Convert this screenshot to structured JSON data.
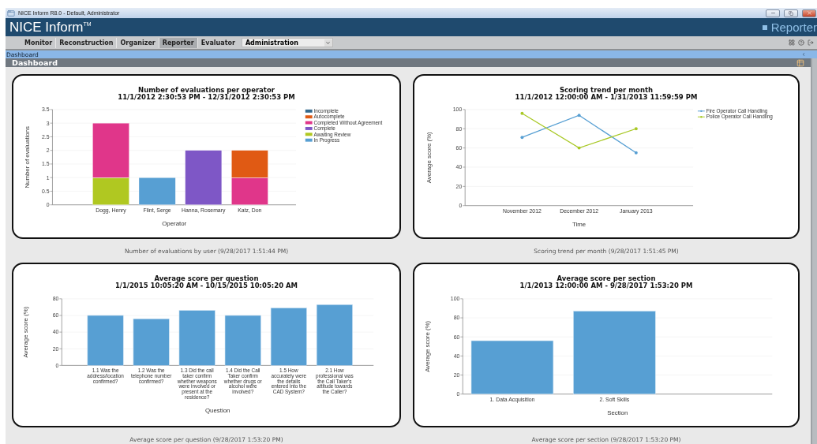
{
  "window": {
    "title": "NICE Inform R8.0 - Default, Administrator"
  },
  "header": {
    "brand": "NICE Inform$^{TM}$",
    "module": "Reporter"
  },
  "nav": {
    "items": [
      {
        "label": "Monitor",
        "selected": false
      },
      {
        "label": "Reconstruction",
        "selected": false
      },
      {
        "label": "Organizer",
        "selected": false
      },
      {
        "label": "Reporter",
        "selected": true
      },
      {
        "label": "Evaluator",
        "selected": false
      }
    ],
    "dropdown": {
      "value": "Administration"
    }
  },
  "breadcrumb": "Dashboard",
  "page_title": "Dashboard",
  "widgets": [
    {
      "caption": "Number of evaluations by user (9/28/2017 1:51:44 PM)",
      "period": "11/1/2012 2:30:53 PM - 12/31/2012 2:30:53 PM",
      "chart_data": {
        "type": "bar",
        "stacked": true,
        "grid": true,
        "legend": true,
        "title": "Number of evaluations per operator",
        "xlabel": "Operator",
        "ylabel": "Number of evaluations",
        "categories": [
          "Dogg, Henry",
          "Flint, Serge",
          "Hanna, Rosemary",
          "Katz, Don"
        ],
        "ylim": [
          0,
          3.5
        ],
        "yticks": [
          0,
          0.5,
          1,
          1.5,
          2,
          2.5,
          3,
          3.5
        ],
        "series": [
          {
            "name": "Incomplete",
            "color": "#356a8e",
            "values": [
              null,
              null,
              null,
              null
            ]
          },
          {
            "name": "Autocomplete",
            "color": "#e05a14",
            "values": [
              null,
              null,
              null,
              1
            ]
          },
          {
            "name": "Completed Without Agreement",
            "color": "#e0368a",
            "values": [
              2,
              null,
              null,
              1
            ]
          },
          {
            "name": "Complete",
            "color": "#7e57c6",
            "values": [
              null,
              null,
              2,
              null
            ]
          },
          {
            "name": "Awaiting Review",
            "color": "#b0c821",
            "values": [
              1,
              null,
              null,
              null
            ]
          },
          {
            "name": "In Progress",
            "color": "#579fd3",
            "values": [
              null,
              1,
              null,
              null
            ]
          }
        ]
      }
    },
    {
      "caption": "Scoring trend per month (9/28/2017 1:51:45 PM)",
      "period": "11/1/2012 12:00:00 AM - 1/31/2013 11:59:59 PM",
      "chart_data": {
        "type": "line",
        "grid": true,
        "legend": true,
        "title": "Scoring trend per month",
        "xlabel": "Time",
        "ylabel": "Average score (%)",
        "categories": [
          "November 2012",
          "December 2012",
          "January 2013"
        ],
        "ylim": [
          0,
          100
        ],
        "yticks": [
          0,
          20,
          40,
          60,
          80,
          100
        ],
        "series": [
          {
            "name": "Fire Operator Call Handling",
            "color": "#579fd3",
            "values": [
              71,
              94,
              55
            ]
          },
          {
            "name": "Police Operator Call Handling",
            "color": "#a8c824",
            "values": [
              96,
              60,
              80
            ]
          }
        ]
      }
    },
    {
      "caption": "Average score per question (9/28/2017 1:53:20 PM)",
      "period": "1/1/2015 10:05:20 AM - 10/15/2015 10:05:20 AM",
      "chart_data": {
        "type": "bar",
        "grid": true,
        "title": "Average score per question",
        "xlabel": "Question",
        "ylabel": "Average score (%)",
        "categories": [
          "1.1 Was the address/location confirmed?",
          "1.2 Was the telephone number confirmed?",
          "1.3 Did the call taker confirm whether weapons were involved or present at the residence?",
          "1.4 Did the Call Taker confirm whether drugs or alcohol were involved?",
          "1.5 How accurately were the details entered into the CAD System?",
          "2.1 How professional was the Call Taker's attitude towards the Caller?"
        ],
        "ylim": [
          0,
          80
        ],
        "yticks": [
          0,
          20,
          40,
          60,
          80
        ],
        "values": [
          60,
          56,
          66,
          60,
          69,
          73
        ]
      }
    },
    {
      "caption": "Average score per section (9/28/2017 1:53:20 PM)",
      "period": "1/1/2013 12:00:00 AM - 9/28/2017 1:53:20 PM",
      "chart_data": {
        "type": "bar",
        "grid": true,
        "title": "Average score per section",
        "xlabel": "Section",
        "ylabel": "Average score (%)",
        "categories": [
          "1. Data Acquisition",
          "2. Soft Skills"
        ],
        "ylim": [
          0,
          100
        ],
        "yticks": [
          0,
          20,
          40,
          60,
          80,
          100
        ],
        "values": [
          56,
          87
        ]
      }
    }
  ]
}
